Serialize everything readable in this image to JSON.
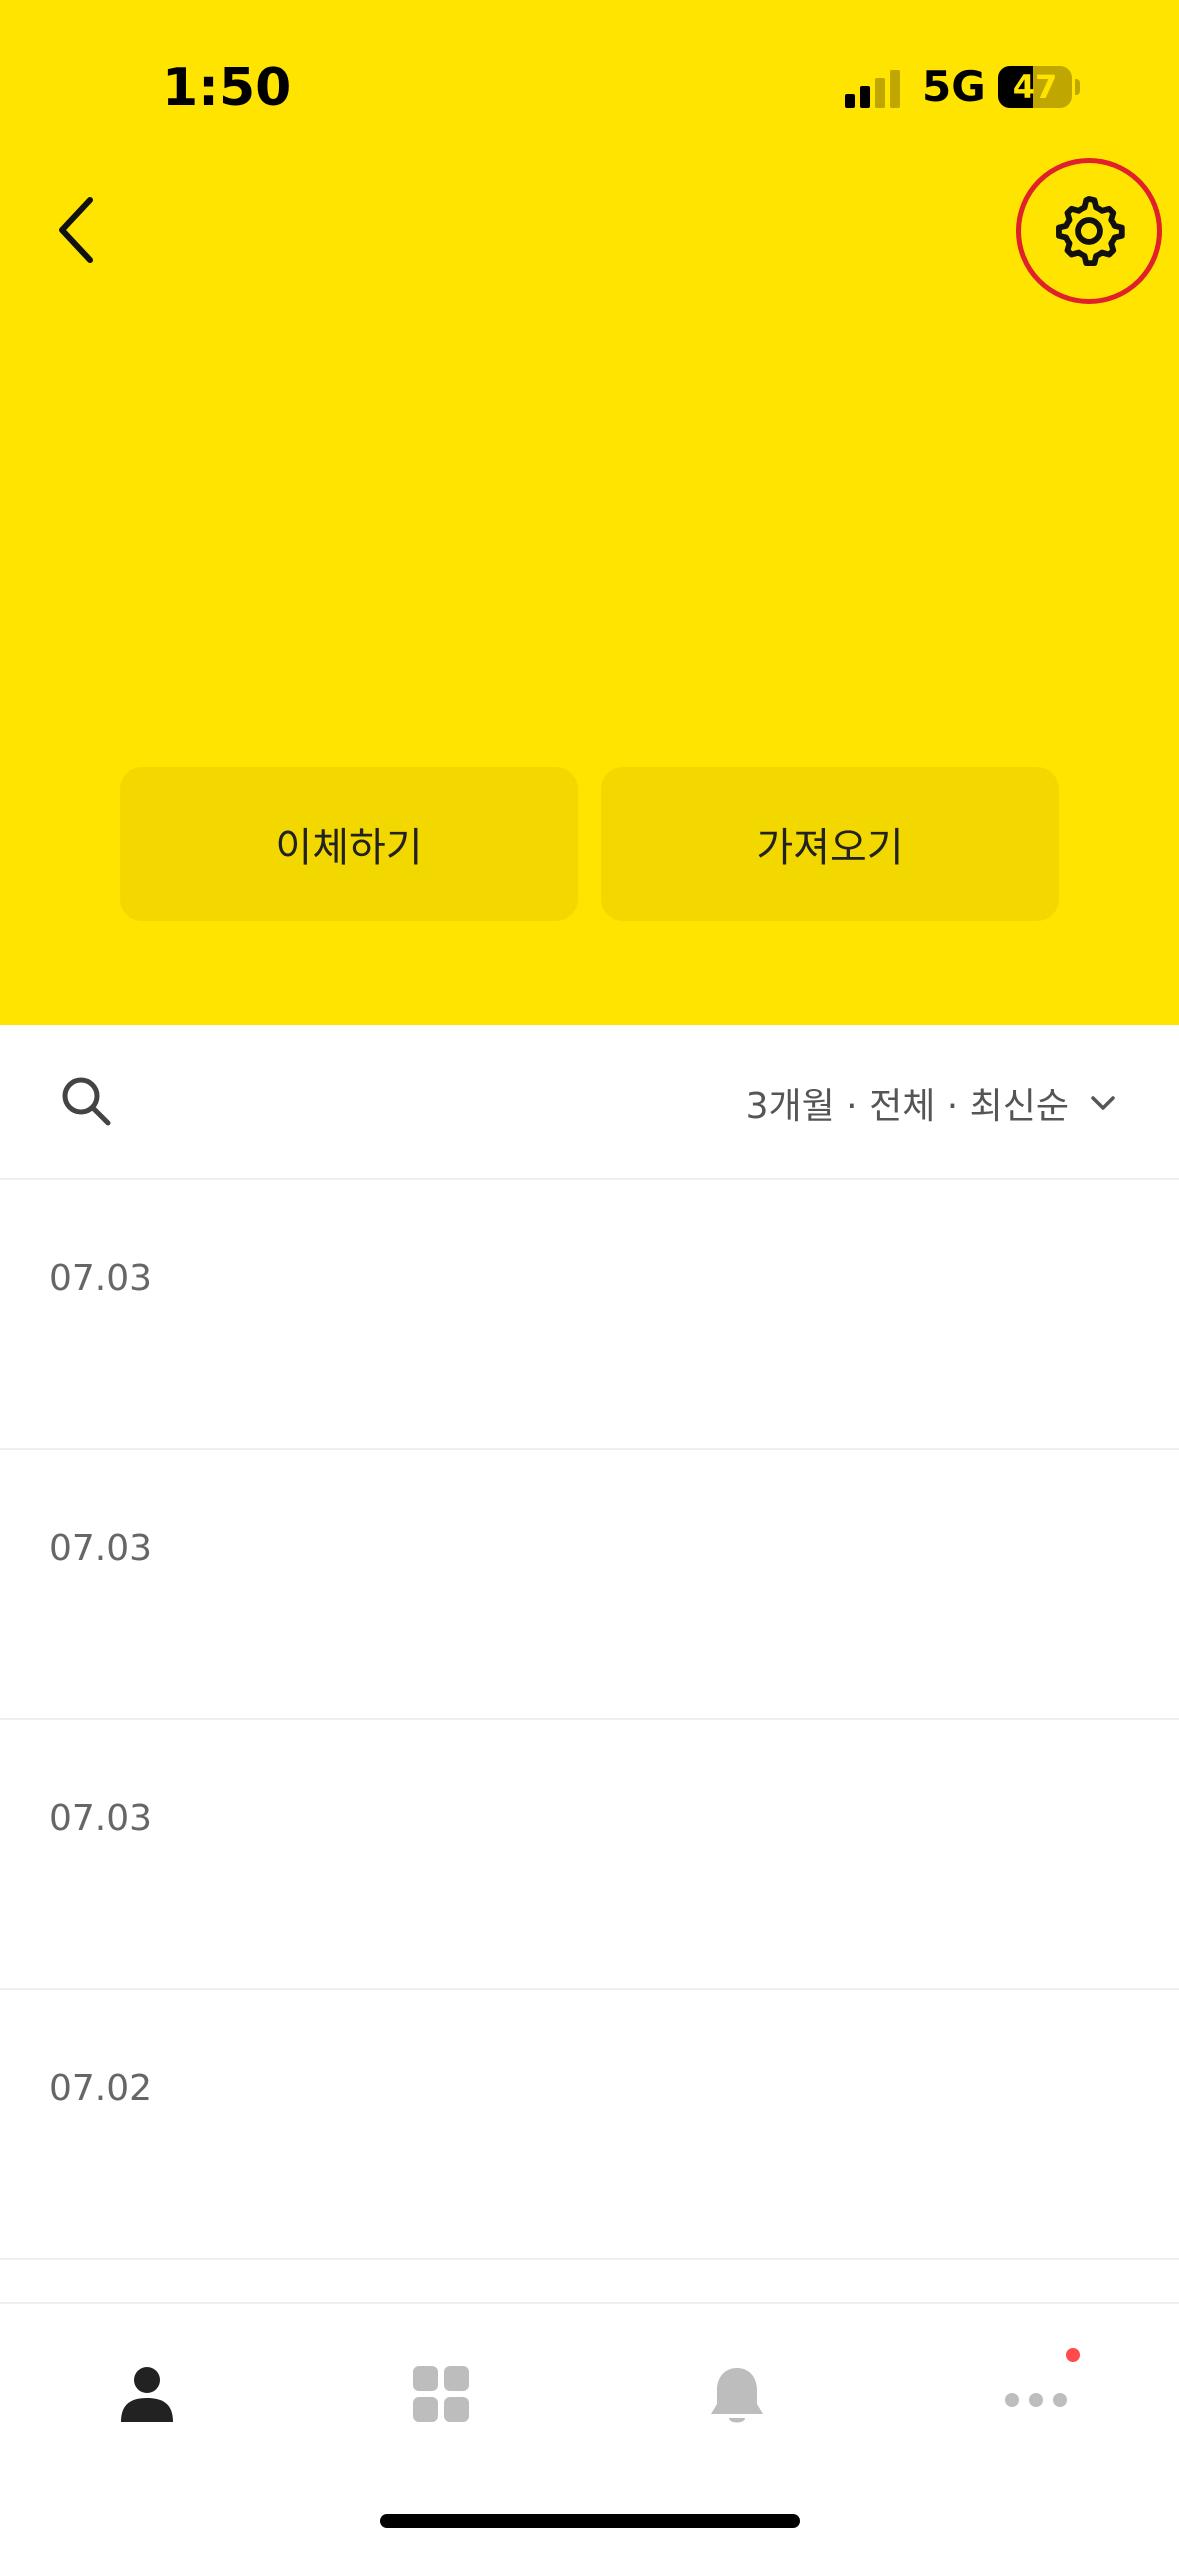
{
  "status_bar": {
    "time": "1:50",
    "network": "5G",
    "battery": "47",
    "battery_level": 0.47
  },
  "header": {
    "actions": {
      "transfer_label": "이체하기",
      "import_label": "가져오기"
    }
  },
  "filter": {
    "label": "3개월 · 전체 · 최신순"
  },
  "transactions": [
    {
      "date": "07.03"
    },
    {
      "date": "07.03"
    },
    {
      "date": "07.03"
    },
    {
      "date": "07.02"
    }
  ],
  "icons": {
    "back": "chevron-left-icon",
    "settings": "gear-icon",
    "search": "search-icon",
    "dropdown": "chevron-down-icon",
    "nav_profile": "person-icon",
    "nav_apps": "grid-icon",
    "nav_alerts": "bell-icon",
    "nav_more": "more-dots-icon"
  },
  "colors": {
    "header_bg": "#FFE400",
    "action_button_bg": "#F3D800",
    "highlight_ring": "#E0202A",
    "badge": "#FF4B4B"
  }
}
